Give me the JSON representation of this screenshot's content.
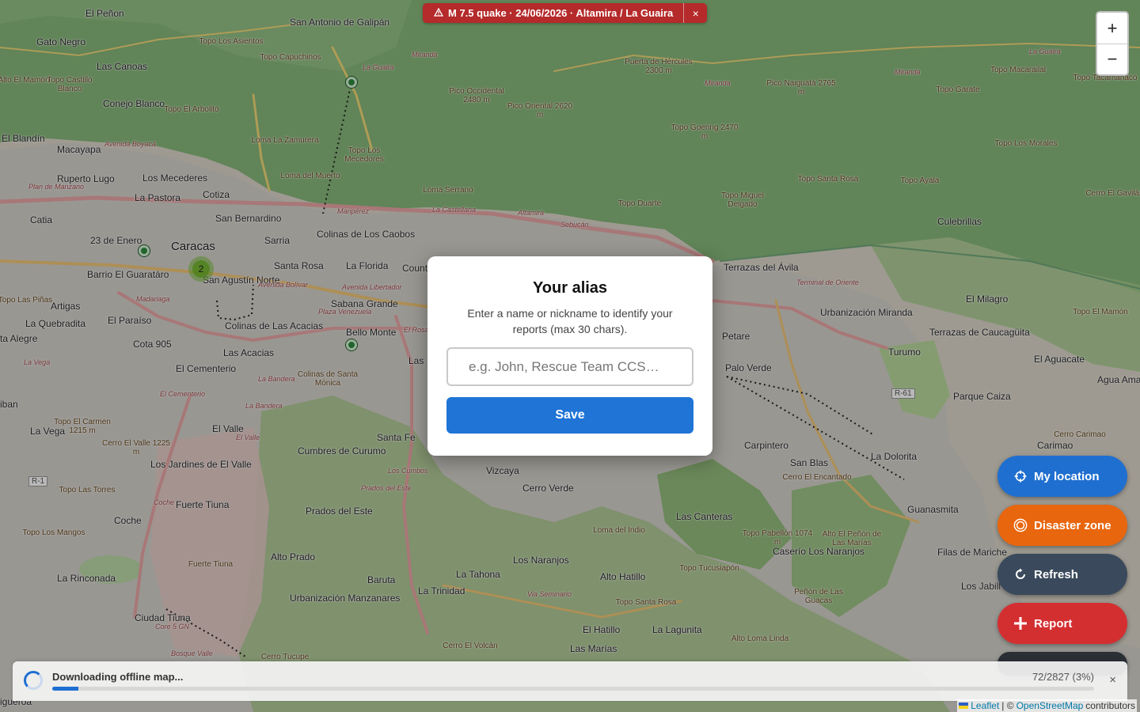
{
  "alert": {
    "text": "M 7.5 quake · 24/06/2026 · Altamira / La Guaira",
    "icon": "warning-icon",
    "close_icon": "×",
    "color": "#b52a2a"
  },
  "zoom": {
    "in_label": "+",
    "out_label": "−"
  },
  "map": {
    "towns": [
      {
        "name": "El Peñon"
      },
      {
        "name": "Gato Negro"
      },
      {
        "name": "Las Canoas"
      },
      {
        "name": "Conejo Blanco"
      },
      {
        "name": "El Blandín"
      },
      {
        "name": "Macayapa"
      },
      {
        "name": "Ruperto Lugo"
      },
      {
        "name": "Los Mecederes"
      },
      {
        "name": "La Pastora"
      },
      {
        "name": "Cotiza"
      },
      {
        "name": "San Bernardino"
      },
      {
        "name": "Catia"
      },
      {
        "name": "23 de Enero"
      },
      {
        "name": "Sarria"
      },
      {
        "name": "Colinas de Los Caobos"
      },
      {
        "name": "Santa Rosa"
      },
      {
        "name": "La Florida"
      },
      {
        "name": "Barrio El Guaratáro"
      },
      {
        "name": "San Agustín Norte"
      },
      {
        "name": "Artigas"
      },
      {
        "name": "Sabana Grande"
      },
      {
        "name": "La Quebradita"
      },
      {
        "name": "El Paraíso"
      },
      {
        "name": "Colinas de Las Acacias"
      },
      {
        "name": "Las Acacias"
      },
      {
        "name": "Bello Monte"
      },
      {
        "name": "Cota 905"
      },
      {
        "name": "El Cementerio"
      },
      {
        "name": "El Valle"
      },
      {
        "name": "La Vega"
      },
      {
        "name": "Los Jardines de El Valle"
      },
      {
        "name": "Santa Fe"
      },
      {
        "name": "Cumbres de Curumo"
      },
      {
        "name": "Vizcaya"
      },
      {
        "name": "Cerro Verde"
      },
      {
        "name": "Fuerte Tiuna"
      },
      {
        "name": "Coche"
      },
      {
        "name": "Prados del Este"
      },
      {
        "name": "Alto Prado"
      },
      {
        "name": "Los Naranjos"
      },
      {
        "name": "La Rinconada"
      },
      {
        "name": "Baruta"
      },
      {
        "name": "La Tahona"
      },
      {
        "name": "La Trinidad"
      },
      {
        "name": "Alto Hatillo"
      },
      {
        "name": "Urbanización Manzanares"
      },
      {
        "name": "Ciudad Tiuna"
      },
      {
        "name": "El Hatillo"
      },
      {
        "name": "La Lagunita"
      },
      {
        "name": "Las Marías"
      },
      {
        "name": "Las Canteras"
      },
      {
        "name": "Caserío Los Naranjos"
      },
      {
        "name": "Terrazas del Ávila"
      },
      {
        "name": "Petare"
      },
      {
        "name": "Palo Verde"
      },
      {
        "name": "Urbanización Miranda"
      },
      {
        "name": "Turumo"
      },
      {
        "name": "Terrazas de Caucagüita"
      },
      {
        "name": "El Milagro"
      },
      {
        "name": "El Aguacate"
      },
      {
        "name": "Parque Caiza"
      },
      {
        "name": "Carpintero"
      },
      {
        "name": "San Blas"
      },
      {
        "name": "La Dolorita"
      },
      {
        "name": "Guanasmita"
      },
      {
        "name": "Filas de Mariche"
      },
      {
        "name": "Los Jabill"
      },
      {
        "name": "Carimao"
      },
      {
        "name": "Culebrillas"
      },
      {
        "name": "San Antonio de Galipán"
      },
      {
        "name": "Agua Ama"
      },
      {
        "name": "ta Alegre"
      },
      {
        "name": "iban"
      },
      {
        "name": "igueroa"
      },
      {
        "name": "Las"
      },
      {
        "name": "Count"
      }
    ],
    "city": "Caracas",
    "peaks": [
      {
        "name": "Topo Los Asientos"
      },
      {
        "name": "Topo Capuchinos"
      },
      {
        "name": "Alto El Mamón"
      },
      {
        "name": "Topo Castillo Blanco"
      },
      {
        "name": "Topo El Arbolito"
      },
      {
        "name": "Loma La Zamurera"
      },
      {
        "name": "Topo Los Mecedores"
      },
      {
        "name": "Loma del Muerto"
      },
      {
        "name": "Pico Occidental 2480 m"
      },
      {
        "name": "Pico Oriental 2620 m"
      },
      {
        "name": "Puerta de Hércules 2300 m"
      },
      {
        "name": "Pico Naiguatá 2765 m"
      },
      {
        "name": "Topo Goering 2470 m"
      },
      {
        "name": "Topo Macarailal"
      },
      {
        "name": "Topo Garate"
      },
      {
        "name": "Topo Tacamahaco"
      },
      {
        "name": "Topo Los Morales"
      },
      {
        "name": "Topo Santa Rosa"
      },
      {
        "name": "Topo Ayala"
      },
      {
        "name": "Topo Miguel Delgado"
      },
      {
        "name": "Topo Duarte"
      },
      {
        "name": "Loma Serrano"
      },
      {
        "name": "Cerro El Gavilán"
      },
      {
        "name": "Topo El Mamón"
      },
      {
        "name": "Topo Las Piñas"
      },
      {
        "name": "Topo El Carmen 1215 m"
      },
      {
        "name": "Cerro El Valle 1225 m"
      },
      {
        "name": "Topo Las Torres"
      },
      {
        "name": "Topo Los Mangos"
      },
      {
        "name": "Loma del Indio"
      },
      {
        "name": "Topo Pabellón 1074 m"
      },
      {
        "name": "Alto El Peñón de Las Marías"
      },
      {
        "name": "Topo Tucusiapón"
      },
      {
        "name": "Topo Santa Rosa"
      },
      {
        "name": "Alto Loma Linda"
      },
      {
        "name": "Peñón de Las Guacas"
      },
      {
        "name": "Cerro El Encantado"
      },
      {
        "name": "Cerro El Volcán"
      },
      {
        "name": "Cerro Tucupe"
      },
      {
        "name": "Cerro Carimao"
      },
      {
        "name": "Colinas de Santa Mónica"
      },
      {
        "name": "Fuerte Tiuna"
      }
    ],
    "roads": [
      {
        "name": "Avenida Boyacá"
      },
      {
        "name": "Plan de Manzano"
      },
      {
        "name": "Maripérez"
      },
      {
        "name": "La Castellana"
      },
      {
        "name": "Altamira"
      },
      {
        "name": "Sebucán"
      },
      {
        "name": "Avenida Bolívar"
      },
      {
        "name": "Madariaga"
      },
      {
        "name": "Plaza Venezuela"
      },
      {
        "name": "Avenida Libertador"
      },
      {
        "name": "El Rosal"
      },
      {
        "name": "La Bandera"
      },
      {
        "name": "El Cementerio"
      },
      {
        "name": "La Bandera"
      },
      {
        "name": "El Valle"
      },
      {
        "name": "La Vega"
      },
      {
        "name": "Coche"
      },
      {
        "name": "Los Cumbos"
      },
      {
        "name": "Prados del Este"
      },
      {
        "name": "Terminal de Oriente"
      },
      {
        "name": "Bosque Valle"
      },
      {
        "name": "Via Seminario"
      },
      {
        "name": "Miranda"
      },
      {
        "name": "Miranda"
      },
      {
        "name": "La Guaira"
      },
      {
        "name": "La Guaira"
      },
      {
        "name": "Miranda"
      },
      {
        "name": "Core 5 GN"
      }
    ],
    "refs": [
      {
        "name": "R-1"
      },
      {
        "name": "R-61"
      }
    ],
    "cluster_count": "2"
  },
  "modal": {
    "title": "Your alias",
    "description": "Enter a name or nickname to identify your reports (max 30 chars).",
    "input_placeholder": "e.g. John, Rescue Team CCS…",
    "input_value": "",
    "save_label": "Save"
  },
  "actions": [
    {
      "label": "My location",
      "icon": "crosshair-icon",
      "color": "#1f6fd0"
    },
    {
      "label": "Disaster zone",
      "icon": "target-icon",
      "color": "#e8660e"
    },
    {
      "label": "Refresh",
      "icon": "refresh-icon",
      "color": "#3a4a5c"
    },
    {
      "label": "Report",
      "icon": "plus-icon",
      "color": "#d42f30"
    }
  ],
  "download": {
    "message": "Downloading offline map...",
    "count": "72/2827 (3%)",
    "progress_fraction": 0.025,
    "close_icon": "×"
  },
  "attribution": {
    "leaflet": "Leaflet",
    "separator": "| ©",
    "osm": "OpenStreetMap",
    "suffix": "contributors"
  }
}
